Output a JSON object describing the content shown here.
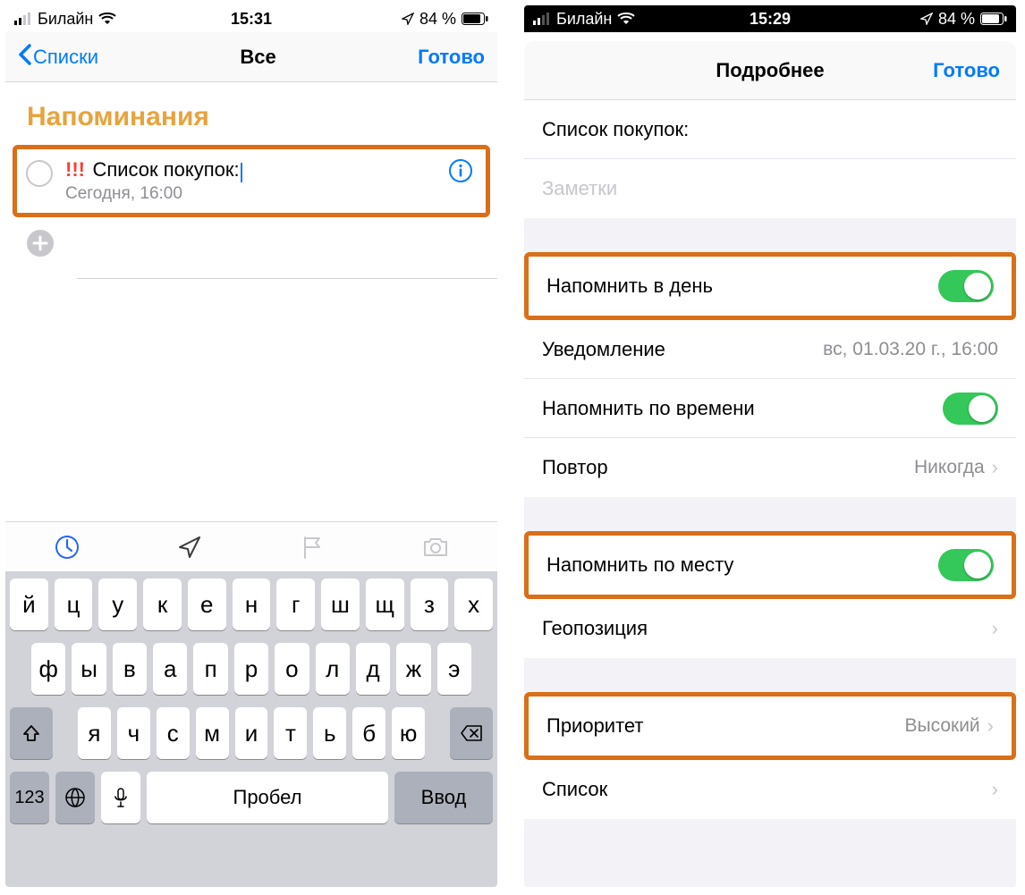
{
  "left": {
    "status": {
      "carrier": "Билайн",
      "time": "15:31",
      "battery_text": "84 %"
    },
    "nav": {
      "back": "Списки",
      "title": "Все",
      "done": "Готово"
    },
    "section_title": "Напоминания",
    "reminder": {
      "priority_marks": "!!!",
      "title": "Список покупок:",
      "subtitle": "Сегодня, 16:00"
    },
    "quickbar": {
      "clock": "clock-icon",
      "location": "location-arrow-icon",
      "flag": "flag-icon",
      "camera": "camera-icon"
    },
    "keyboard": {
      "row1": [
        "й",
        "ц",
        "у",
        "к",
        "е",
        "н",
        "г",
        "ш",
        "щ",
        "з",
        "х"
      ],
      "row2": [
        "ф",
        "ы",
        "в",
        "а",
        "п",
        "р",
        "о",
        "л",
        "д",
        "ж",
        "э"
      ],
      "row3": [
        "я",
        "ч",
        "с",
        "м",
        "и",
        "т",
        "ь",
        "б",
        "ю"
      ],
      "numbers": "123",
      "space": "Пробел",
      "enter": "Ввод"
    }
  },
  "right": {
    "status": {
      "carrier": "Билайн",
      "time": "15:29",
      "battery_text": "84 %"
    },
    "nav": {
      "title": "Подробнее",
      "done": "Готово"
    },
    "fields": {
      "title_value": "Список покупок:",
      "notes_placeholder": "Заметки"
    },
    "rows": {
      "remind_day": "Напомнить в день",
      "notification_label": "Уведомление",
      "notification_value": "вс, 01.03.20 г., 16:00",
      "remind_time": "Напомнить по времени",
      "repeat_label": "Повтор",
      "repeat_value": "Никогда",
      "remind_location": "Напомнить по месту",
      "geo_label": "Геопозиция",
      "priority_label": "Приоритет",
      "priority_value": "Высокий",
      "list_label": "Список"
    }
  }
}
